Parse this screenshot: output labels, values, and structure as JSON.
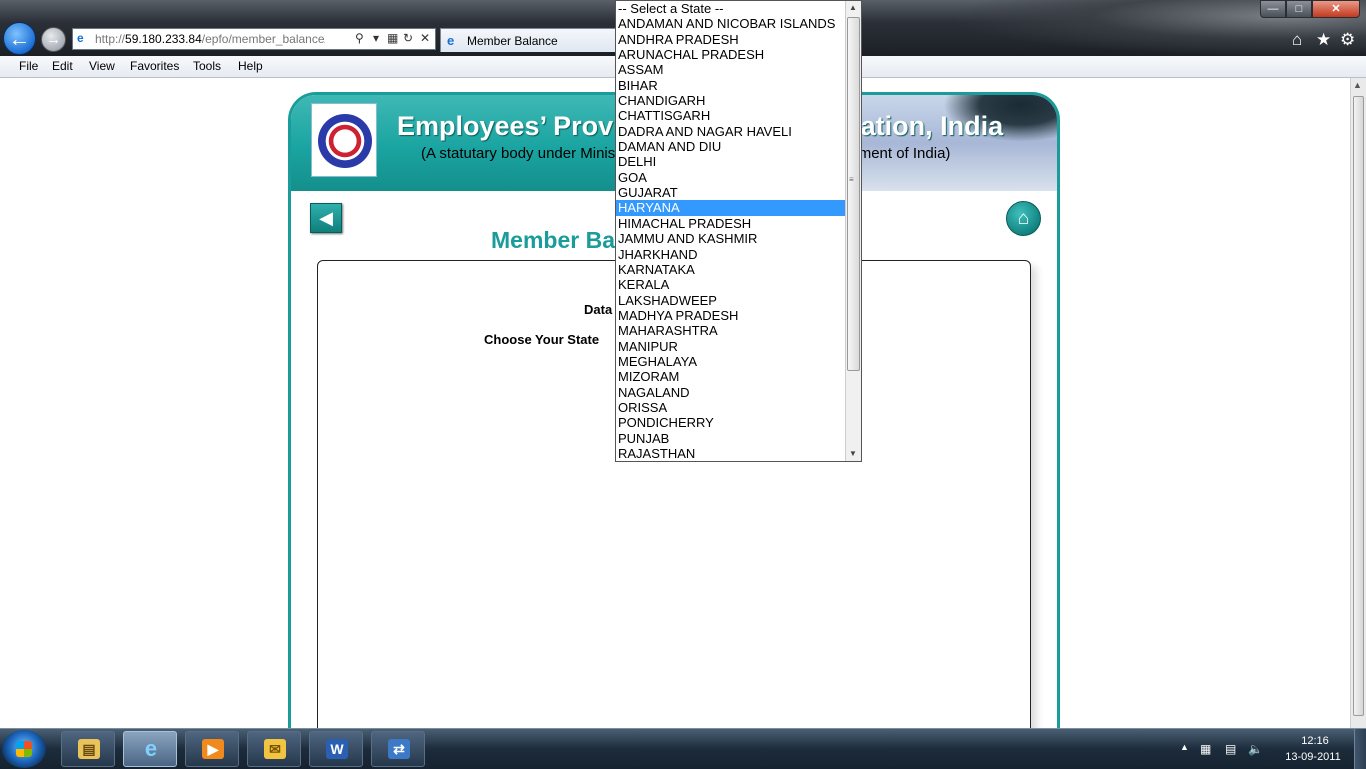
{
  "browser": {
    "url_prefix": "http://",
    "url_host": "59.180.233.84",
    "url_path": "/epfo/member_balance/mei",
    "tab_title": "Member Balance",
    "menu": [
      "File",
      "Edit",
      "View",
      "Favorites",
      "Tools",
      "Help"
    ]
  },
  "page": {
    "org_title": "Employees’ Provident Fund Organisation, India",
    "org_subtitle": "(A statutary body under Ministry of Labour & Employment, Government of India)",
    "page_title": "Member Balance Information",
    "data_label": "Data",
    "state_label": "Choose Your State"
  },
  "dropdown": {
    "selected": "HARYANA",
    "options": [
      "-- Select a State --",
      "ANDAMAN AND NICOBAR ISLANDS",
      "ANDHRA PRADESH",
      "ARUNACHAL PRADESH",
      "ASSAM",
      "BIHAR",
      "CHANDIGARH",
      "CHATTISGARH",
      "DADRA AND NAGAR HAVELI",
      "DAMAN AND DIU",
      "DELHI",
      "GOA",
      "GUJARAT",
      "HARYANA",
      "HIMACHAL PRADESH",
      "JAMMU AND KASHMIR",
      "JHARKHAND",
      "KARNATAKA",
      "KERALA",
      "LAKSHADWEEP",
      "MADHYA PRADESH",
      "MAHARASHTRA",
      "MANIPUR",
      "MEGHALAYA",
      "MIZORAM",
      "NAGALAND",
      "ORISSA",
      "PONDICHERRY",
      "PUNJAB",
      "RAJASTHAN"
    ]
  },
  "taskbar": {
    "time": "12:16",
    "date": "13-09-2011"
  },
  "colors": {
    "accent": "#1a9c9a",
    "selection": "#3399ff"
  }
}
